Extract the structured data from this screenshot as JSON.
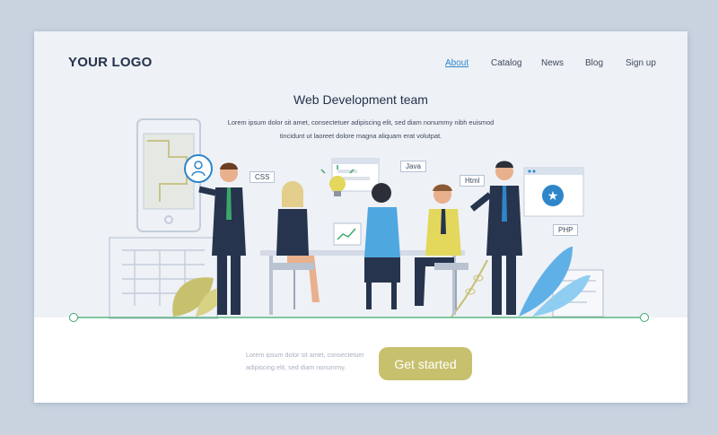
{
  "header": {
    "logo": "YOUR LOGO",
    "nav": [
      {
        "label": "About",
        "active": true
      },
      {
        "label": "Catalog",
        "active": false
      },
      {
        "label": "News",
        "active": false
      },
      {
        "label": "Blog",
        "active": false
      },
      {
        "label": "Sign up",
        "active": false
      }
    ]
  },
  "hero": {
    "title": "Web Development team",
    "subtitle_line1": "Lorem ipsum dolor sit amet, consectetuer adipiscing elit, sed diam nonummy nibh euismod",
    "subtitle_line2": "tincidunt ut laoreet dolore magna aliquam erat volutpat."
  },
  "illustration": {
    "tags": [
      "CSS",
      "Java",
      "Html",
      "PHP"
    ],
    "icons": [
      "user-icon",
      "lightbulb-icon",
      "star-icon"
    ]
  },
  "cta": {
    "text_line1": "Lorem ipsum dolor sit amet, consectetuer",
    "text_line2": "adipiscing elit, sed diam nonummy.",
    "button_label": "Get started"
  },
  "colors": {
    "accent": "#2e86c9",
    "button": "#c7c16e",
    "suit": "#27344d",
    "tie": "#3aa86b",
    "background": "#c9d3e0"
  }
}
